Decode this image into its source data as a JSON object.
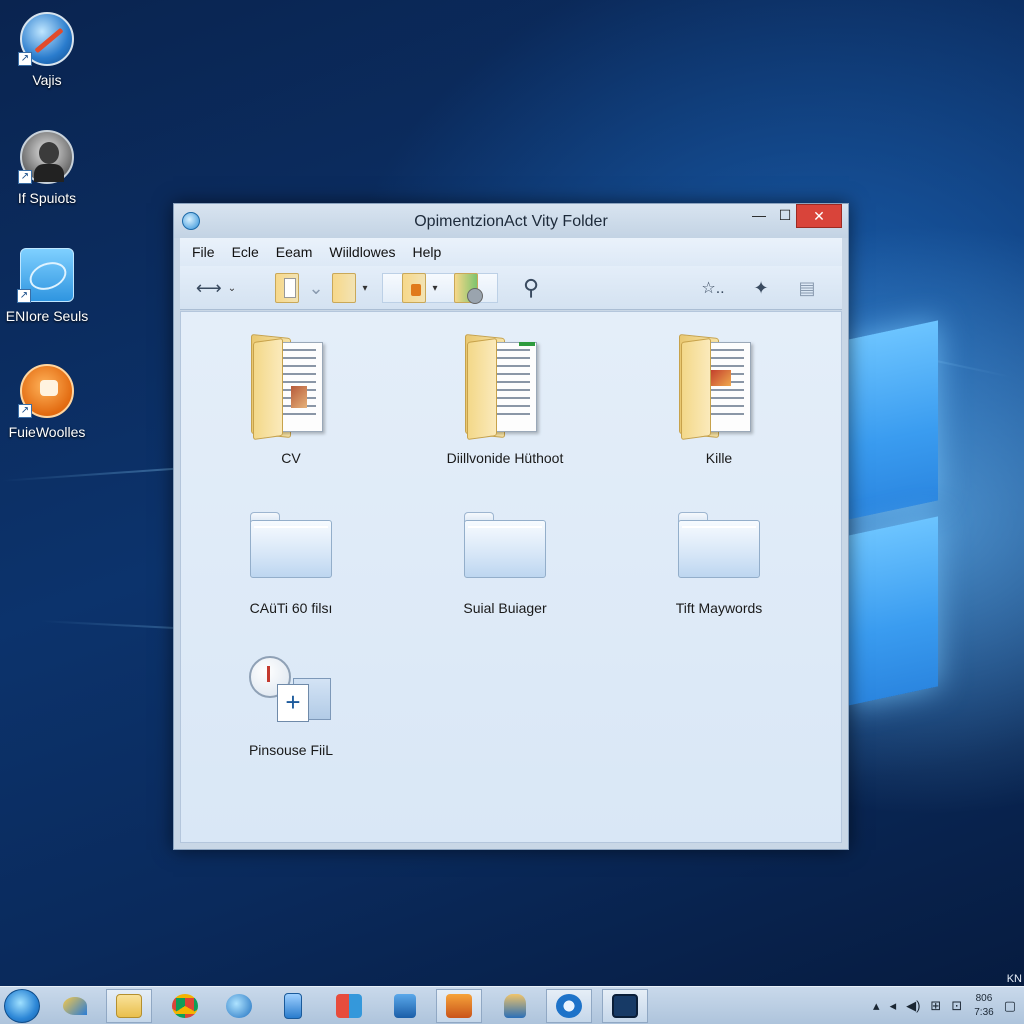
{
  "desktop": {
    "icons": [
      {
        "label": "Vajis",
        "icon": "compass-app-icon"
      },
      {
        "label": "If Spuiots",
        "icon": "person-photo-icon"
      },
      {
        "label": "ENIore Seuls",
        "icon": "blue-folder-icon"
      },
      {
        "label": "FuieWoolles",
        "icon": "orange-app-icon"
      }
    ]
  },
  "window": {
    "title": "OpimentzionAct Vity Folder",
    "controls": {
      "minimize": "—",
      "maximize": "☐",
      "close": "✕"
    },
    "menu": [
      "File",
      "Ecle",
      "Eeam",
      "Wiildlowes",
      "Help"
    ],
    "toolbar": [
      "back-forward-icon",
      "folder-doc-icon",
      "folder-icon",
      "folder-orange-icon",
      "folder-disc-icon",
      "search-icon",
      "star-icon",
      "sparkle-icon",
      "grid-view-icon"
    ],
    "items": [
      {
        "label": "CV",
        "icon": "open-folder-icon"
      },
      {
        "label": "Diillvonide Hüthoot",
        "icon": "open-folder-icon"
      },
      {
        "label": "Kille",
        "icon": "open-folder-icon"
      },
      {
        "label": "CAüTi 60 filsı",
        "icon": "folder-icon"
      },
      {
        "label": "Suial Buiager",
        "icon": "folder-icon"
      },
      {
        "label": "Tift Maywords",
        "icon": "folder-icon"
      },
      {
        "label": "Pinsouse FiiL",
        "icon": "new-file-icon"
      }
    ]
  },
  "taskbar": {
    "tray": {
      "clock_line1": "806",
      "clock_line2": "7:36",
      "corner_text": "KN"
    }
  },
  "colors": {
    "accent": "#2c86d6",
    "close_button": "#d9443a",
    "desktop_bg": "#0c336c"
  }
}
